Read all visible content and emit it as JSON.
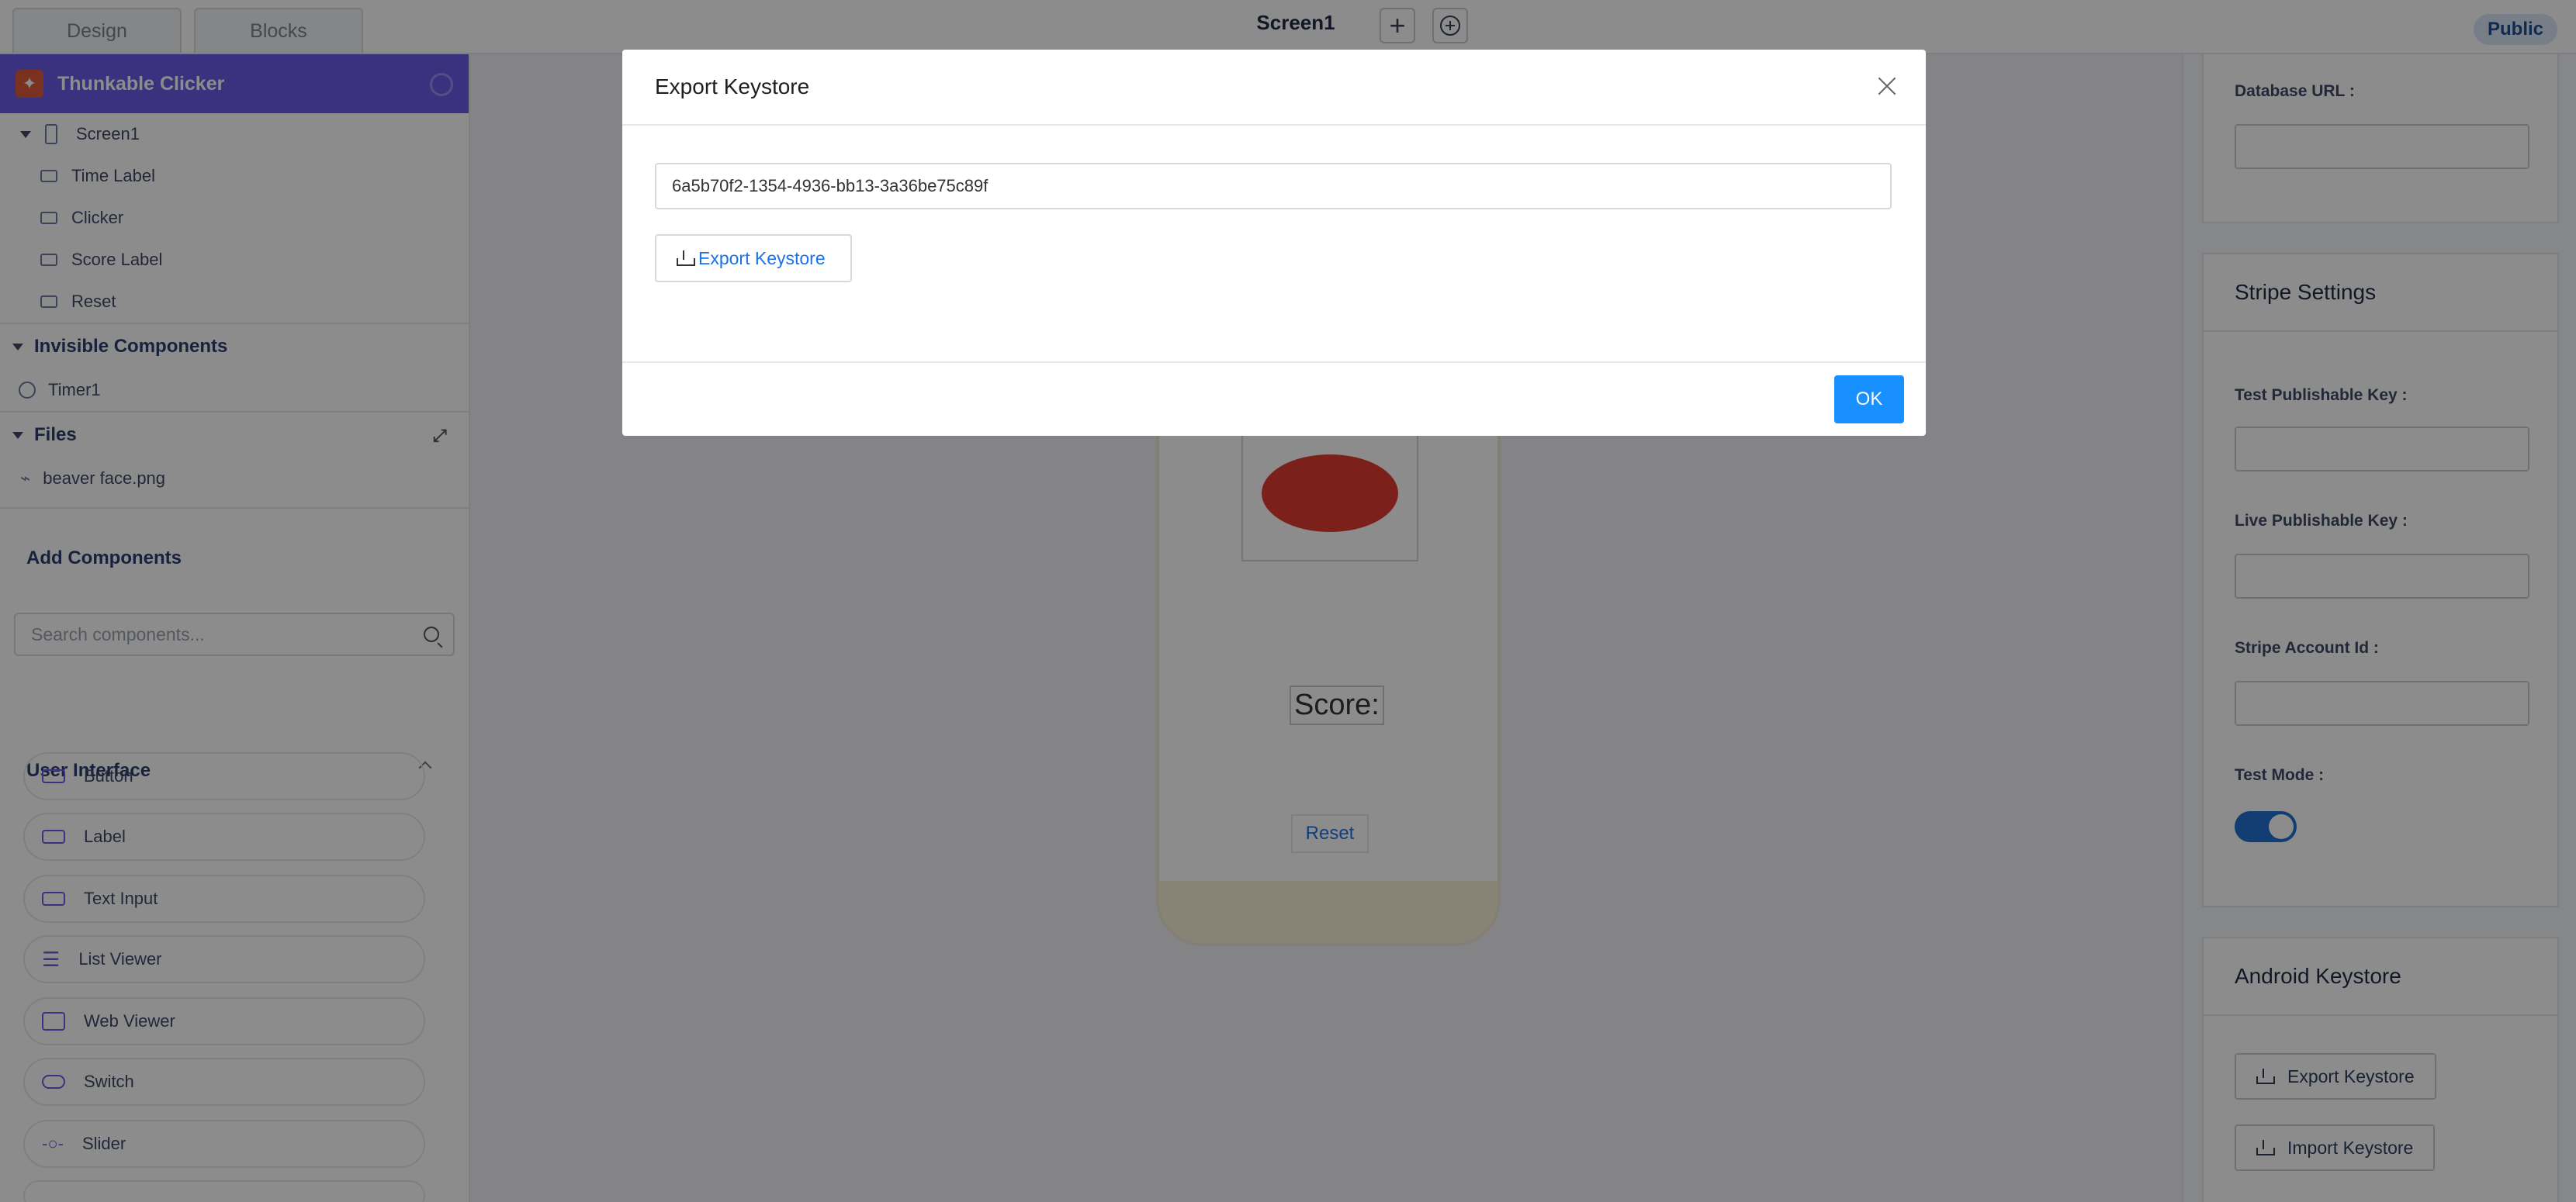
{
  "topbar": {
    "tabs": [
      "Design",
      "Blocks"
    ],
    "screen_title": "Screen1",
    "public_label": "Public"
  },
  "sidebar": {
    "app_name": "Thunkable Clicker",
    "tree": {
      "screen": "Screen1",
      "components": [
        "Time Label",
        "Clicker",
        "Score Label",
        "Reset"
      ]
    },
    "invisible_title": "Invisible Components",
    "invisible_items": [
      "Timer1"
    ],
    "files_title": "Files",
    "files": [
      "beaver face.png"
    ],
    "add_components_title": "Add Components",
    "search_placeholder": "Search components...",
    "ui_section_title": "User Interface",
    "components_list": [
      "Button",
      "Label",
      "Text Input",
      "List Viewer",
      "Web Viewer",
      "Switch",
      "Slider"
    ]
  },
  "canvas": {
    "score_text": "Score:",
    "reset_label": "Reset"
  },
  "right_panel": {
    "database_url_label": "Database URL :",
    "stripe_title": "Stripe Settings",
    "test_key_label": "Test Publishable Key :",
    "live_key_label": "Live Publishable Key :",
    "account_id_label": "Stripe Account Id :",
    "test_mode_label": "Test Mode :",
    "test_mode_on": true,
    "android_title": "Android Keystore",
    "export_label": "Export Keystore",
    "import_label": "Import Keystore"
  },
  "modal": {
    "title": "Export Keystore",
    "keystore_id": "6a5b70f2-1354-4936-bb13-3a36be75c89f",
    "export_button": "Export Keystore",
    "ok_button": "OK"
  },
  "colors": {
    "accent": "#6c5ce7",
    "primary_button": "#1890ff",
    "link": "#1a73e8"
  }
}
